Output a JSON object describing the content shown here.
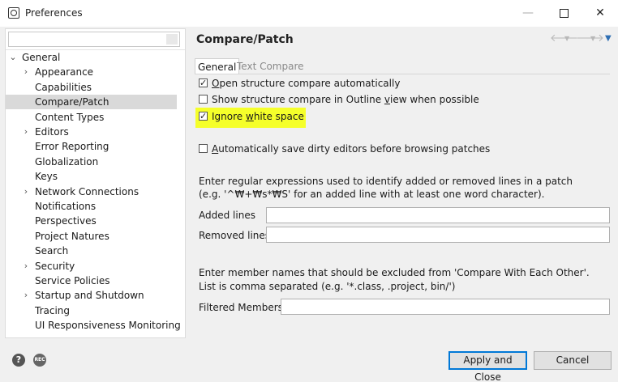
{
  "window": {
    "title": "Preferences"
  },
  "sidebar": {
    "filter_placeholder": "",
    "items": [
      {
        "label": "General",
        "twisty": "expanded",
        "indent": 0
      },
      {
        "label": "Appearance",
        "twisty": "collapsed",
        "indent": 1
      },
      {
        "label": "Capabilities",
        "twisty": "none",
        "indent": 1
      },
      {
        "label": "Compare/Patch",
        "twisty": "none",
        "indent": 1,
        "selected": true
      },
      {
        "label": "Content Types",
        "twisty": "none",
        "indent": 1
      },
      {
        "label": "Editors",
        "twisty": "collapsed",
        "indent": 1
      },
      {
        "label": "Error Reporting",
        "twisty": "none",
        "indent": 1
      },
      {
        "label": "Globalization",
        "twisty": "none",
        "indent": 1
      },
      {
        "label": "Keys",
        "twisty": "none",
        "indent": 1
      },
      {
        "label": "Network Connections",
        "twisty": "collapsed",
        "indent": 1
      },
      {
        "label": "Notifications",
        "twisty": "none",
        "indent": 1
      },
      {
        "label": "Perspectives",
        "twisty": "none",
        "indent": 1
      },
      {
        "label": "Project Natures",
        "twisty": "none",
        "indent": 1
      },
      {
        "label": "Search",
        "twisty": "none",
        "indent": 1
      },
      {
        "label": "Security",
        "twisty": "collapsed",
        "indent": 1
      },
      {
        "label": "Service Policies",
        "twisty": "none",
        "indent": 1
      },
      {
        "label": "Startup and Shutdown",
        "twisty": "collapsed",
        "indent": 1
      },
      {
        "label": "Tracing",
        "twisty": "none",
        "indent": 1
      },
      {
        "label": "UI Responsiveness Monitoring",
        "twisty": "none",
        "indent": 1
      }
    ]
  },
  "page": {
    "title": "Compare/Patch",
    "tabs": [
      {
        "label": "General",
        "active": true
      },
      {
        "label": "Text Compare",
        "active": false
      }
    ],
    "checkboxes": [
      {
        "pre": "",
        "mn": "O",
        "post": "pen structure compare automatically",
        "checked": true
      },
      {
        "pre": "Show structure compare in Outline ",
        "mn": "v",
        "post": "iew when possible",
        "checked": false
      },
      {
        "pre": "Ignore ",
        "mn": "w",
        "post": "hite space",
        "checked": true,
        "highlighted": true
      },
      {
        "pre": "",
        "mn": "A",
        "post": "utomatically save dirty editors before browsing patches",
        "checked": false
      }
    ],
    "patch_desc_1": "Enter regular expressions used to identify added or removed lines in a patch",
    "patch_desc_2": "(e.g. '^₩+₩s*₩S' for an added line with at least one word character).",
    "added_label": "Added lines",
    "added_value": "",
    "removed_label": "Removed lines",
    "removed_value": "",
    "member_desc_1": "Enter member names that should be excluded from 'Compare With Each Other'.",
    "member_desc_2": "List is comma separated (e.g. '*.class, .project, bin/')",
    "filtered_label": "Filtered Members:",
    "filtered_value": ""
  },
  "footer": {
    "apply_close": "Apply and Close",
    "cancel": "Cancel",
    "rec_text": "REC"
  },
  "colors": {
    "highlight": "#f5ff2a",
    "selection": "#d9d9d9",
    "accent": "#0078d7"
  }
}
